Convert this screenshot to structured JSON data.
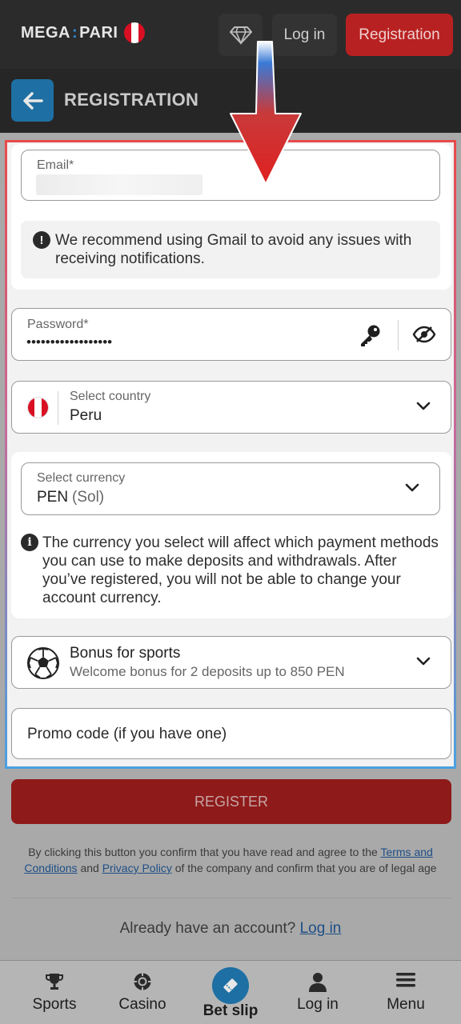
{
  "header": {
    "logo_left": "MEGA",
    "logo_right": "PARI",
    "login_label": "Log in",
    "registration_label": "Registration"
  },
  "subheader": {
    "title": "REGISTRATION"
  },
  "form": {
    "email": {
      "label": "Email*",
      "value": ""
    },
    "gmail_note": "We recommend using Gmail to avoid any issues with receiving notifications.",
    "password": {
      "label": "Password*",
      "value": "••••••••••••••••••"
    },
    "country": {
      "label": "Select country",
      "value": "Peru"
    },
    "currency": {
      "label": "Select currency",
      "code": "PEN",
      "name": "(Sol)"
    },
    "currency_note": "The currency you select will affect which payment methods you can use to make deposits and withdrawals. After you’ve registered, you will not be able to change your account currency.",
    "bonus": {
      "title": "Bonus for sports",
      "subtitle": "Welcome bonus for 2 deposits up to 850 PEN"
    },
    "promo_placeholder": "Promo code (if you have one)",
    "register_label": "REGISTER"
  },
  "terms": {
    "prefix": "By clicking this button you confirm that you have read and agree to the",
    "terms_link": "Terms and Conditions",
    "and": "and",
    "privacy_link": "Privacy Policy",
    "suffix": "of the company and confirm that you are of legal age"
  },
  "login_prompt": {
    "text": "Already have an account?",
    "link": "Log in"
  },
  "bottom_nav": {
    "sports": "Sports",
    "casino": "Casino",
    "betslip": "Bet slip",
    "login": "Log in",
    "menu": "Menu"
  },
  "colors": {
    "brand_red": "#b82121",
    "brand_blue": "#1e6fa3",
    "peru_red": "#d91023"
  }
}
